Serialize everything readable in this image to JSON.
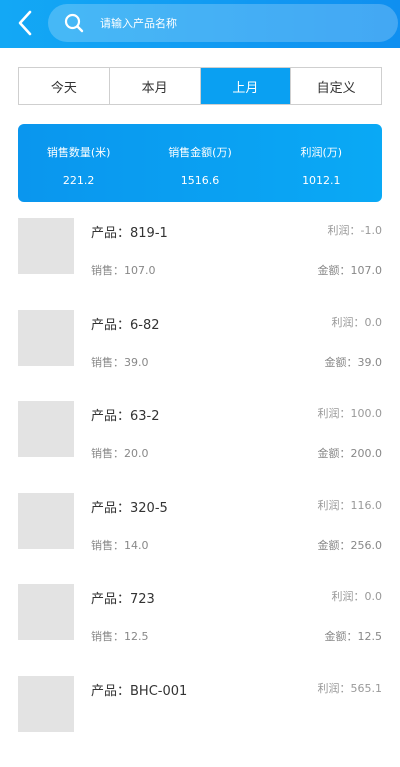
{
  "header": {
    "back_icon": "chevron-left-icon",
    "search_icon": "search-icon",
    "search_placeholder": "请输入产品名称",
    "accent_color": "#0f9ff2"
  },
  "tabs": [
    {
      "label": "今天",
      "active": false
    },
    {
      "label": "本月",
      "active": false
    },
    {
      "label": "上月",
      "active": true
    },
    {
      "label": "自定义",
      "active": false
    }
  ],
  "summary": {
    "sales_qty_label": "销售数量(米)",
    "sales_qty_value": "221.2",
    "sales_amount_label": "销售金额(万)",
    "sales_amount_value": "1516.6",
    "profit_label": "利润(万)",
    "profit_value": "1012.1"
  },
  "products": [
    {
      "name": "产品：819-1",
      "profit": "利润：-1.0",
      "sales": "销售：107.0",
      "amount": "金额：107.0"
    },
    {
      "name": "产品：6-82",
      "profit": "利润：0.0",
      "sales": "销售：39.0",
      "amount": "金额：39.0"
    },
    {
      "name": "产品：63-2",
      "profit": "利润：100.0",
      "sales": "销售：20.0",
      "amount": "金额：200.0"
    },
    {
      "name": "产品：320-5",
      "profit": "利润：116.0",
      "sales": "销售：14.0",
      "amount": "金额：256.0"
    },
    {
      "name": "产品：723",
      "profit": "利润：0.0",
      "sales": "销售：12.5",
      "amount": "金额：12.5"
    },
    {
      "name": "产品：BHC-001",
      "profit": "利润：565.1",
      "sales": "",
      "amount": ""
    }
  ]
}
